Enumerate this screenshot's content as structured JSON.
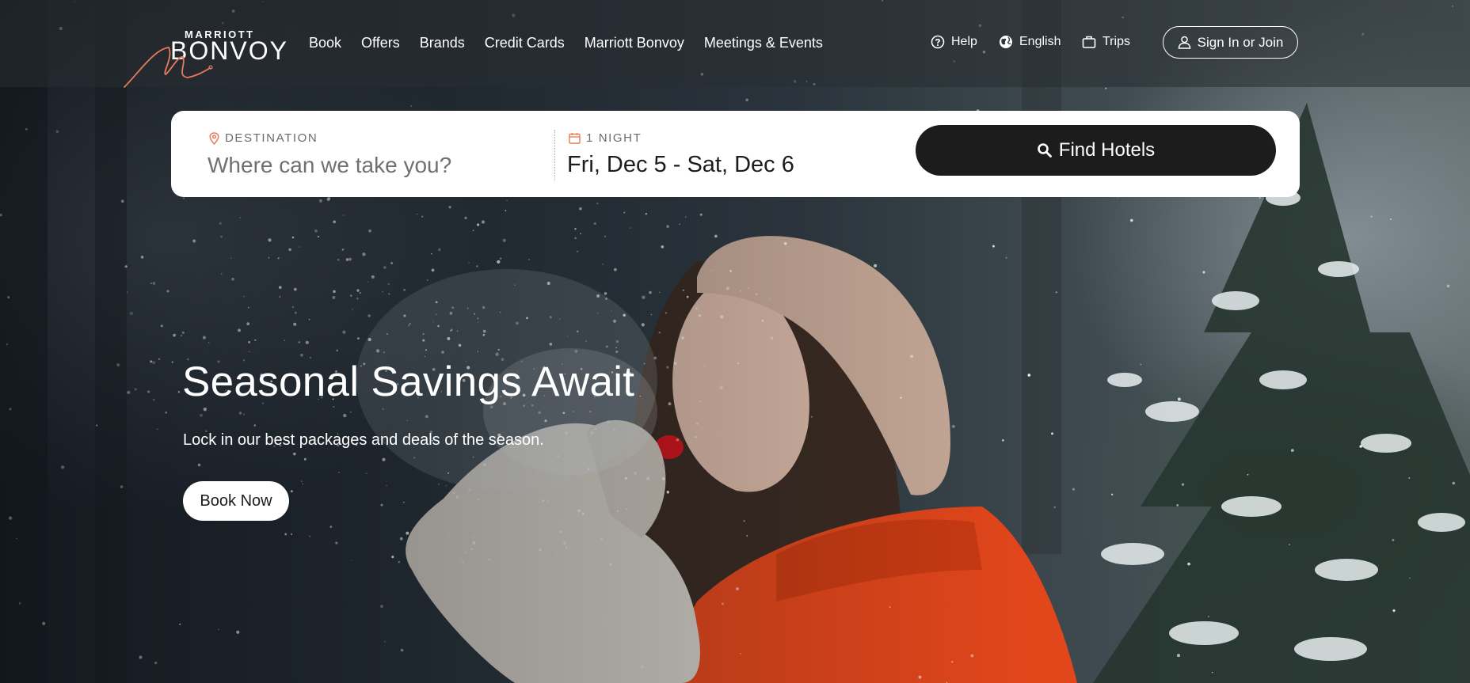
{
  "brand": {
    "name_small": "MARRIOTT",
    "name_big": "BONVOY",
    "accent_color": "#e87a5d"
  },
  "nav": {
    "items": [
      {
        "label": "Book"
      },
      {
        "label": "Offers"
      },
      {
        "label": "Brands"
      },
      {
        "label": "Credit Cards"
      },
      {
        "label": "Marriott Bonvoy"
      },
      {
        "label": "Meetings & Events"
      }
    ]
  },
  "utility": {
    "help": {
      "label": "Help",
      "icon": "help-circle-icon"
    },
    "language": {
      "label": "English",
      "icon": "globe-icon"
    },
    "trips": {
      "label": "Trips",
      "icon": "suitcase-icon"
    },
    "signin": {
      "label": "Sign In or Join",
      "icon": "user-icon"
    }
  },
  "search": {
    "destination_label": "DESTINATION",
    "destination_placeholder": "Where can we take you?",
    "nights_label": "1 NIGHT",
    "dates_value": "Fri, Dec 5 - Sat, Dec 6",
    "find_label": "Find Hotels"
  },
  "hero": {
    "title": "Seasonal Savings Await",
    "subtitle": "Lock in our best packages and deals of the season.",
    "cta_label": "Book Now"
  }
}
